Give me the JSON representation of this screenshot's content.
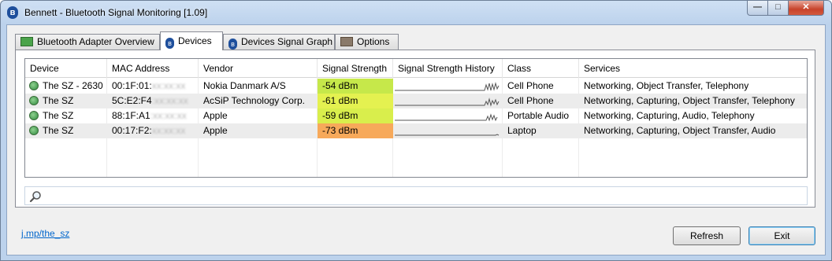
{
  "window": {
    "title": "Bennett - Bluetooth Signal Monitoring [1.09]",
    "controls": {
      "minimize": "—",
      "maximize": "□",
      "close": "✕"
    }
  },
  "tabs": [
    {
      "label": "Bluetooth Adapter Overview",
      "icon": "adapter-icon"
    },
    {
      "label": "Devices",
      "icon": "bluetooth-icon",
      "active": true
    },
    {
      "label": "Devices Signal Graph",
      "icon": "bluetooth-icon"
    },
    {
      "label": "Options",
      "icon": "options-icon"
    }
  ],
  "table": {
    "columns": [
      "Device",
      "MAC Address",
      "Vendor",
      "Signal Strength",
      "Signal Strength History",
      "Class",
      "Services"
    ],
    "rows": [
      {
        "device": "The SZ - 2630",
        "mac": "00:1F:01:",
        "mac_hidden": "xx:xx:xx",
        "vendor": "Nokia Danmark A/S",
        "signal": "-54 dBm",
        "signal_color": "#c6e84a",
        "class": "Cell Phone",
        "services": "Networking, Object Transfer, Telephony"
      },
      {
        "device": "The SZ",
        "mac": "5C:E2:F4",
        "mac_hidden": ":xx:xx:xx",
        "vendor": "AcSiP Technology Corp.",
        "signal": "-61 dBm",
        "signal_color": "#e4f150",
        "class": "Cell Phone",
        "services": "Networking, Capturing, Object Transfer, Telephony"
      },
      {
        "device": "The SZ",
        "mac": "88:1F:A1",
        "mac_hidden": ":xx:xx:xx",
        "vendor": "Apple",
        "signal": "-59 dBm",
        "signal_color": "#d9ee4c",
        "class": "Portable Audio",
        "services": "Networking, Capturing, Audio, Telephony"
      },
      {
        "device": "The SZ",
        "mac": "00:17:F2:",
        "mac_hidden": "xx:xx:xx",
        "vendor": "Apple",
        "signal": "-73 dBm",
        "signal_color": "#f7a95a",
        "class": "Laptop",
        "services": "Networking, Capturing, Object Transfer, Audio"
      }
    ]
  },
  "search": {
    "value": "",
    "placeholder": ""
  },
  "footer": {
    "link": "j.mp/the_sz",
    "refresh_label": "Refresh",
    "exit_label": "Exit"
  },
  "colors": {
    "title_bar": "#bcd2ec",
    "row_alt": "#ececec",
    "link": "#0066cc"
  }
}
